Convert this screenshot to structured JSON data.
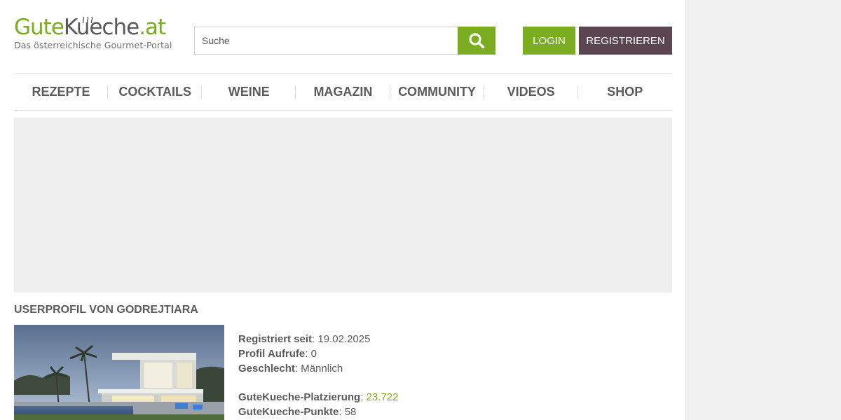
{
  "logo": {
    "part1": "Gute",
    "part2": "Kueche",
    "part3": ".at",
    "tagline": "Das österreichische Gourmet-Portal"
  },
  "search": {
    "placeholder": "Suche",
    "icon": "search-icon"
  },
  "header": {
    "login_label": "LOGIN",
    "register_label": "REGISTRIEREN"
  },
  "nav": {
    "items": [
      {
        "label": "REZEPTE"
      },
      {
        "label": "COCKTAILS"
      },
      {
        "label": "WEINE"
      },
      {
        "label": "MAGAZIN"
      },
      {
        "label": "COMMUNITY"
      },
      {
        "label": "VIDEOS"
      },
      {
        "label": "SHOP"
      }
    ]
  },
  "profile": {
    "title": "USERPROFIL VON GODREJTIARA",
    "registered_label": "Registriert seit",
    "registered_value": "19.02.2025",
    "views_label": "Profil Aufrufe",
    "views_value": "0",
    "gender_label": "Geschlecht",
    "gender_value": "Männlich",
    "rank_label": "GuteKueche-Platzierung",
    "rank_value": "23.722",
    "points_label": "GuteKueche-Punkte",
    "points_value": "58"
  },
  "colors": {
    "brand_green": "#7aad1f",
    "register_bg": "#5a4550",
    "ad_bg": "#efefef",
    "sidebar_bg": "#f0f0f0"
  }
}
